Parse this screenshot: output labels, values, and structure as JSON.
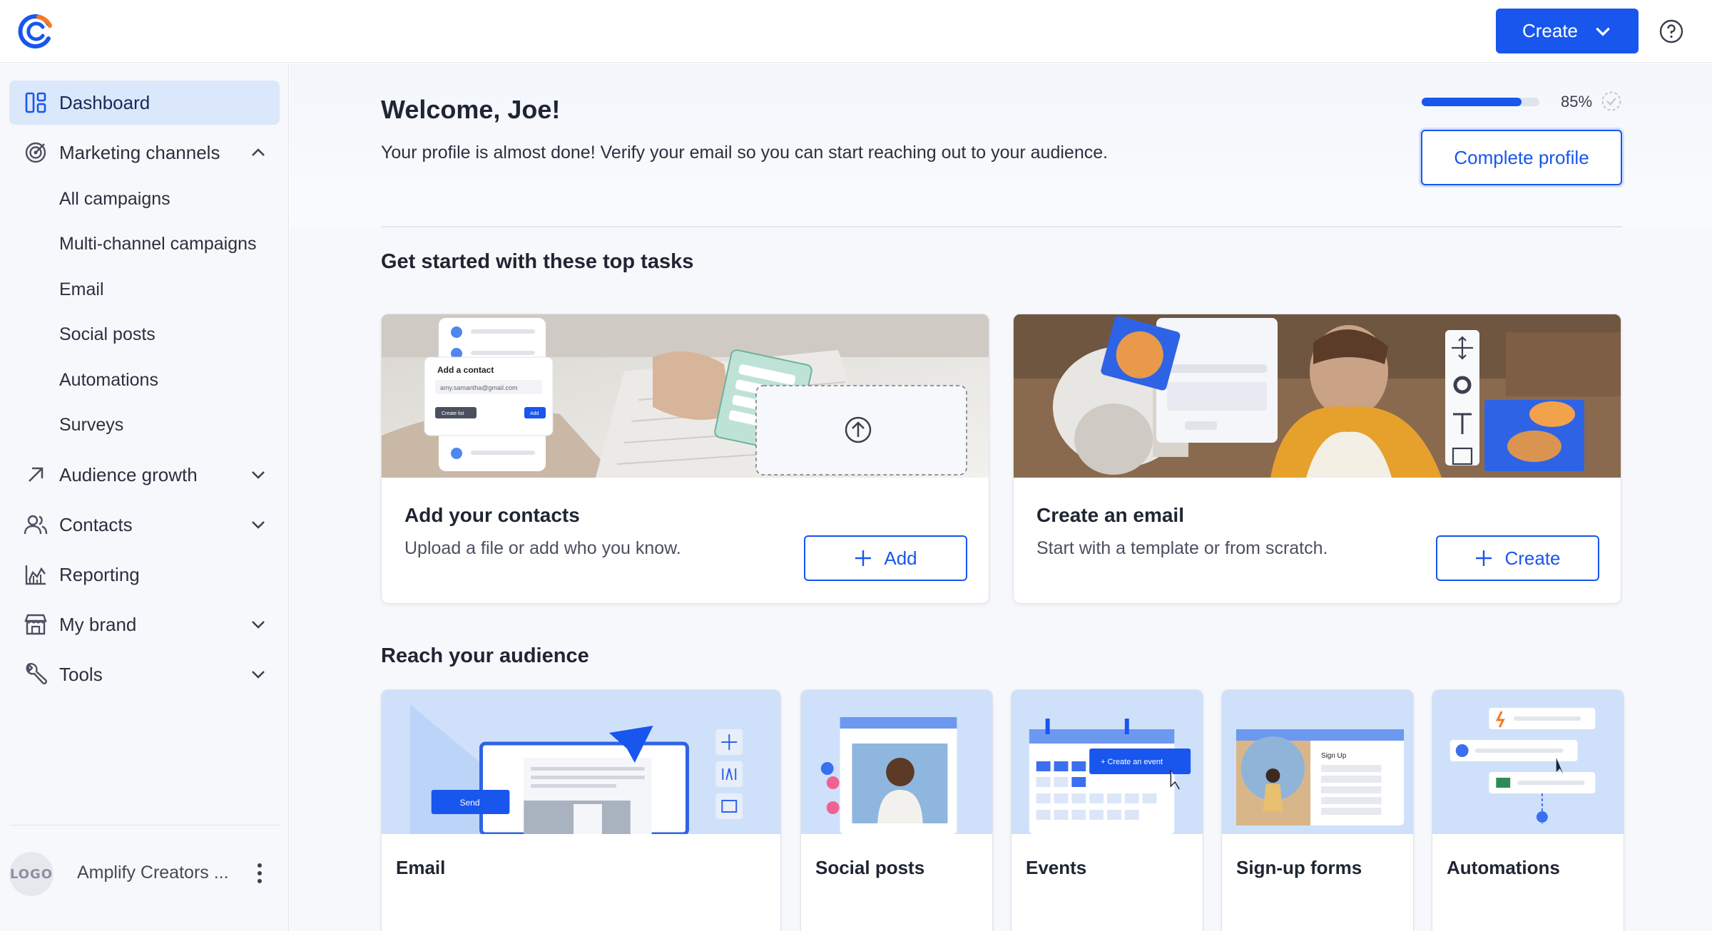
{
  "header": {
    "create_label": "Create"
  },
  "sidebar": {
    "items": [
      {
        "label": "Dashboard"
      },
      {
        "label": "Marketing channels"
      },
      {
        "label": "Audience growth"
      },
      {
        "label": "Contacts"
      },
      {
        "label": "Reporting"
      },
      {
        "label": "My brand"
      },
      {
        "label": "Tools"
      }
    ],
    "subitems": [
      {
        "label": "All campaigns"
      },
      {
        "label": "Multi-channel campaigns"
      },
      {
        "label": "Email"
      },
      {
        "label": "Social posts"
      },
      {
        "label": "Automations"
      },
      {
        "label": "Surveys"
      }
    ],
    "account": {
      "avatar_text": "LOGO",
      "name": "Amplify Creators ..."
    }
  },
  "welcome": {
    "title": "Welcome, Joe!",
    "text": "Your profile is almost done! Verify your email so you can start reaching out to your audience.",
    "progress_percent": 85,
    "progress_label": "85%",
    "complete_button": "Complete profile"
  },
  "tasks": {
    "title": "Get started with these top tasks",
    "cards": [
      {
        "title": "Add your contacts",
        "description": "Upload a file or add who you know.",
        "button": "Add",
        "illustration": {
          "panel_title": "Add a contact",
          "email": "amy.samantha@gmail.com",
          "secondary_btn": "Create list",
          "primary_btn": "Add"
        }
      },
      {
        "title": "Create an email",
        "description": "Start with a template or from scratch.",
        "button": "Create"
      }
    ]
  },
  "audience": {
    "title": "Reach your audience",
    "cards": [
      {
        "label": "Email",
        "art_text": "Send"
      },
      {
        "label": "Social posts"
      },
      {
        "label": "Events",
        "art_text": "+ Create an event"
      },
      {
        "label": "Sign-up forms",
        "art_text": "Sign Up"
      },
      {
        "label": "Automations"
      }
    ]
  },
  "colors": {
    "brand_blue": "#1856ed",
    "active_nav_bg": "#dbe7fb"
  }
}
